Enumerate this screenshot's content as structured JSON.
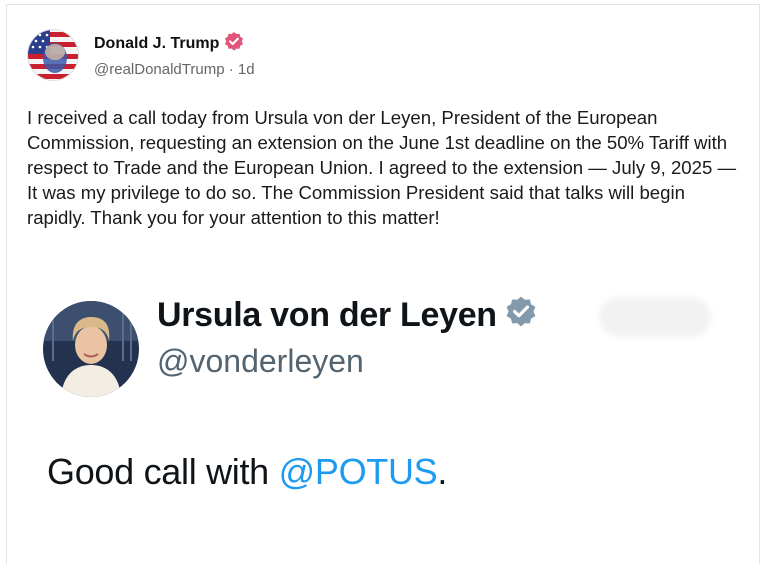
{
  "post": {
    "author_name": "Donald J. Trump",
    "handle": "@realDonaldTrump",
    "separator": "·",
    "time_ago": "1d",
    "body": "I received a call today from Ursula von der Leyen, President of the European Commission, requesting an extension on the June 1st deadline on the 50% Tariff with respect to Trade and the European Union. I agreed to the extension — July 9, 2025 — It was my privilege to do so. The Commission President said that talks will begin rapidly. Thank you for your attention to this matter!",
    "verified_icon": "verified-badge-icon"
  },
  "quoted": {
    "author_name": "Ursula von der Leyen",
    "handle": "@vonderleyen",
    "text_before": "Good call with ",
    "mention": "@POTUS",
    "text_after": ".",
    "verified_icon": "verified-badge-icon"
  },
  "colors": {
    "verified_pink": "#e0567a",
    "verified_grey": "#829aab",
    "mention_blue": "#1d9bf0"
  }
}
